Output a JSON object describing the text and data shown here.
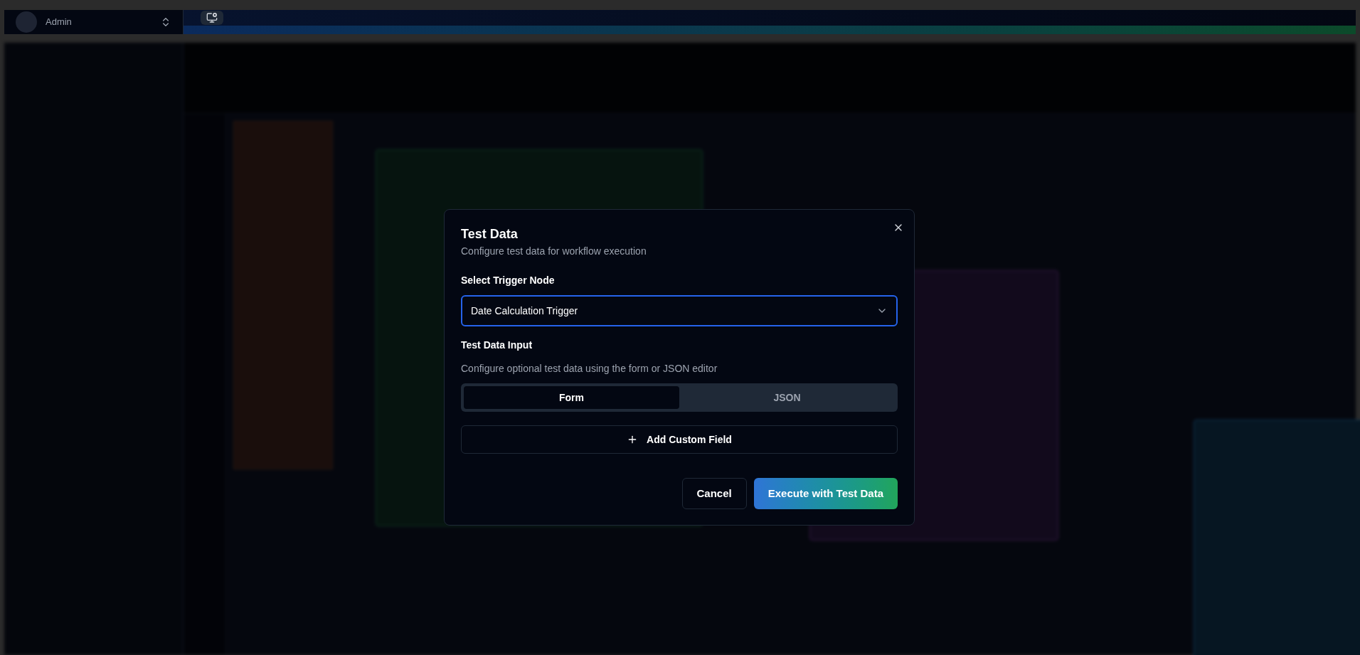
{
  "account": {
    "name": "Admin"
  },
  "dialog": {
    "title": "Test Data",
    "subtitle": "Configure test data for workflow execution",
    "trigger_label": "Select Trigger Node",
    "trigger_value": "Date Calculation Trigger",
    "input_label": "Test Data Input",
    "input_hint": "Configure optional test data using the form or JSON editor",
    "tabs": [
      {
        "label": "Form",
        "selected": true
      },
      {
        "label": "JSON",
        "selected": false
      }
    ],
    "add_field": "Add Custom Field",
    "buttons": [
      {
        "kind": "secondary",
        "label": "Cancel"
      },
      {
        "kind": "primary",
        "label": "Execute with Test Data"
      }
    ]
  }
}
